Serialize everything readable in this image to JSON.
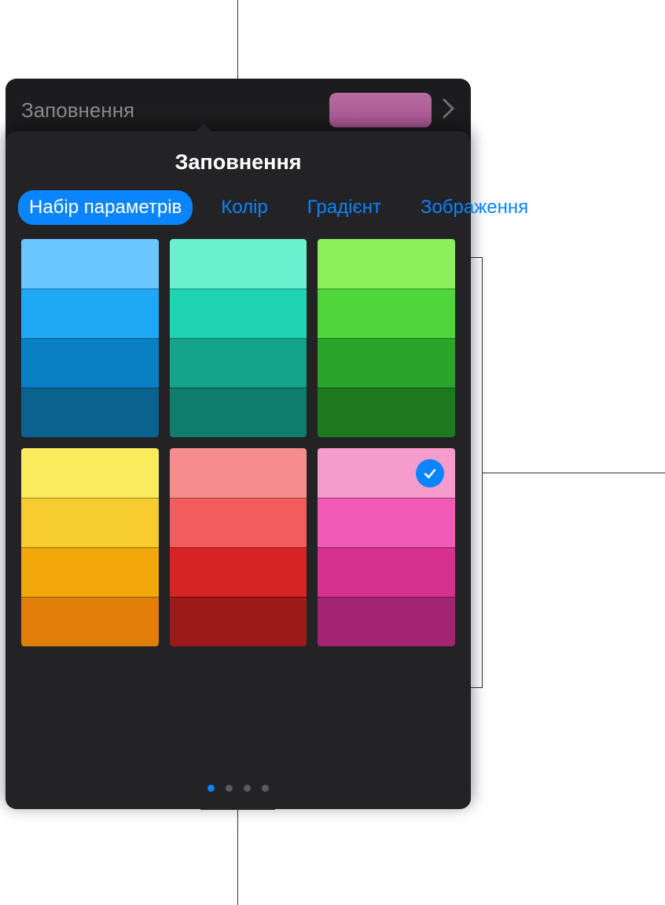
{
  "header": {
    "label": "Заповнення",
    "preview_color": "#a8538e"
  },
  "popover": {
    "title": "Заповнення",
    "tabs": [
      {
        "label": "Набір параметрів",
        "active": true
      },
      {
        "label": "Колір",
        "active": false
      },
      {
        "label": "Градієнт",
        "active": false
      },
      {
        "label": "Зображення",
        "active": false
      }
    ],
    "swatch_groups": [
      {
        "colors": [
          "#6ac6ff",
          "#1fa8f5",
          "#0a7fc4",
          "#0a628f"
        ],
        "selected": false
      },
      {
        "colors": [
          "#6bf0d0",
          "#1fd4b0",
          "#14a38b",
          "#0f7d6b"
        ],
        "selected": false
      },
      {
        "colors": [
          "#8bf05c",
          "#4fd63a",
          "#2aa52a",
          "#1e7a1e"
        ],
        "selected": false
      },
      {
        "colors": [
          "#fbec5d",
          "#f7cc2f",
          "#f0a80a",
          "#e07e0a"
        ],
        "selected": false
      },
      {
        "colors": [
          "#f78c8c",
          "#f25c5c",
          "#d62424",
          "#9c1a1a"
        ],
        "selected": false
      },
      {
        "colors": [
          "#f59ccc",
          "#f25ab8",
          "#d6318f",
          "#a32470"
        ],
        "selected": true
      }
    ],
    "pages": {
      "count": 4,
      "active": 0
    }
  }
}
